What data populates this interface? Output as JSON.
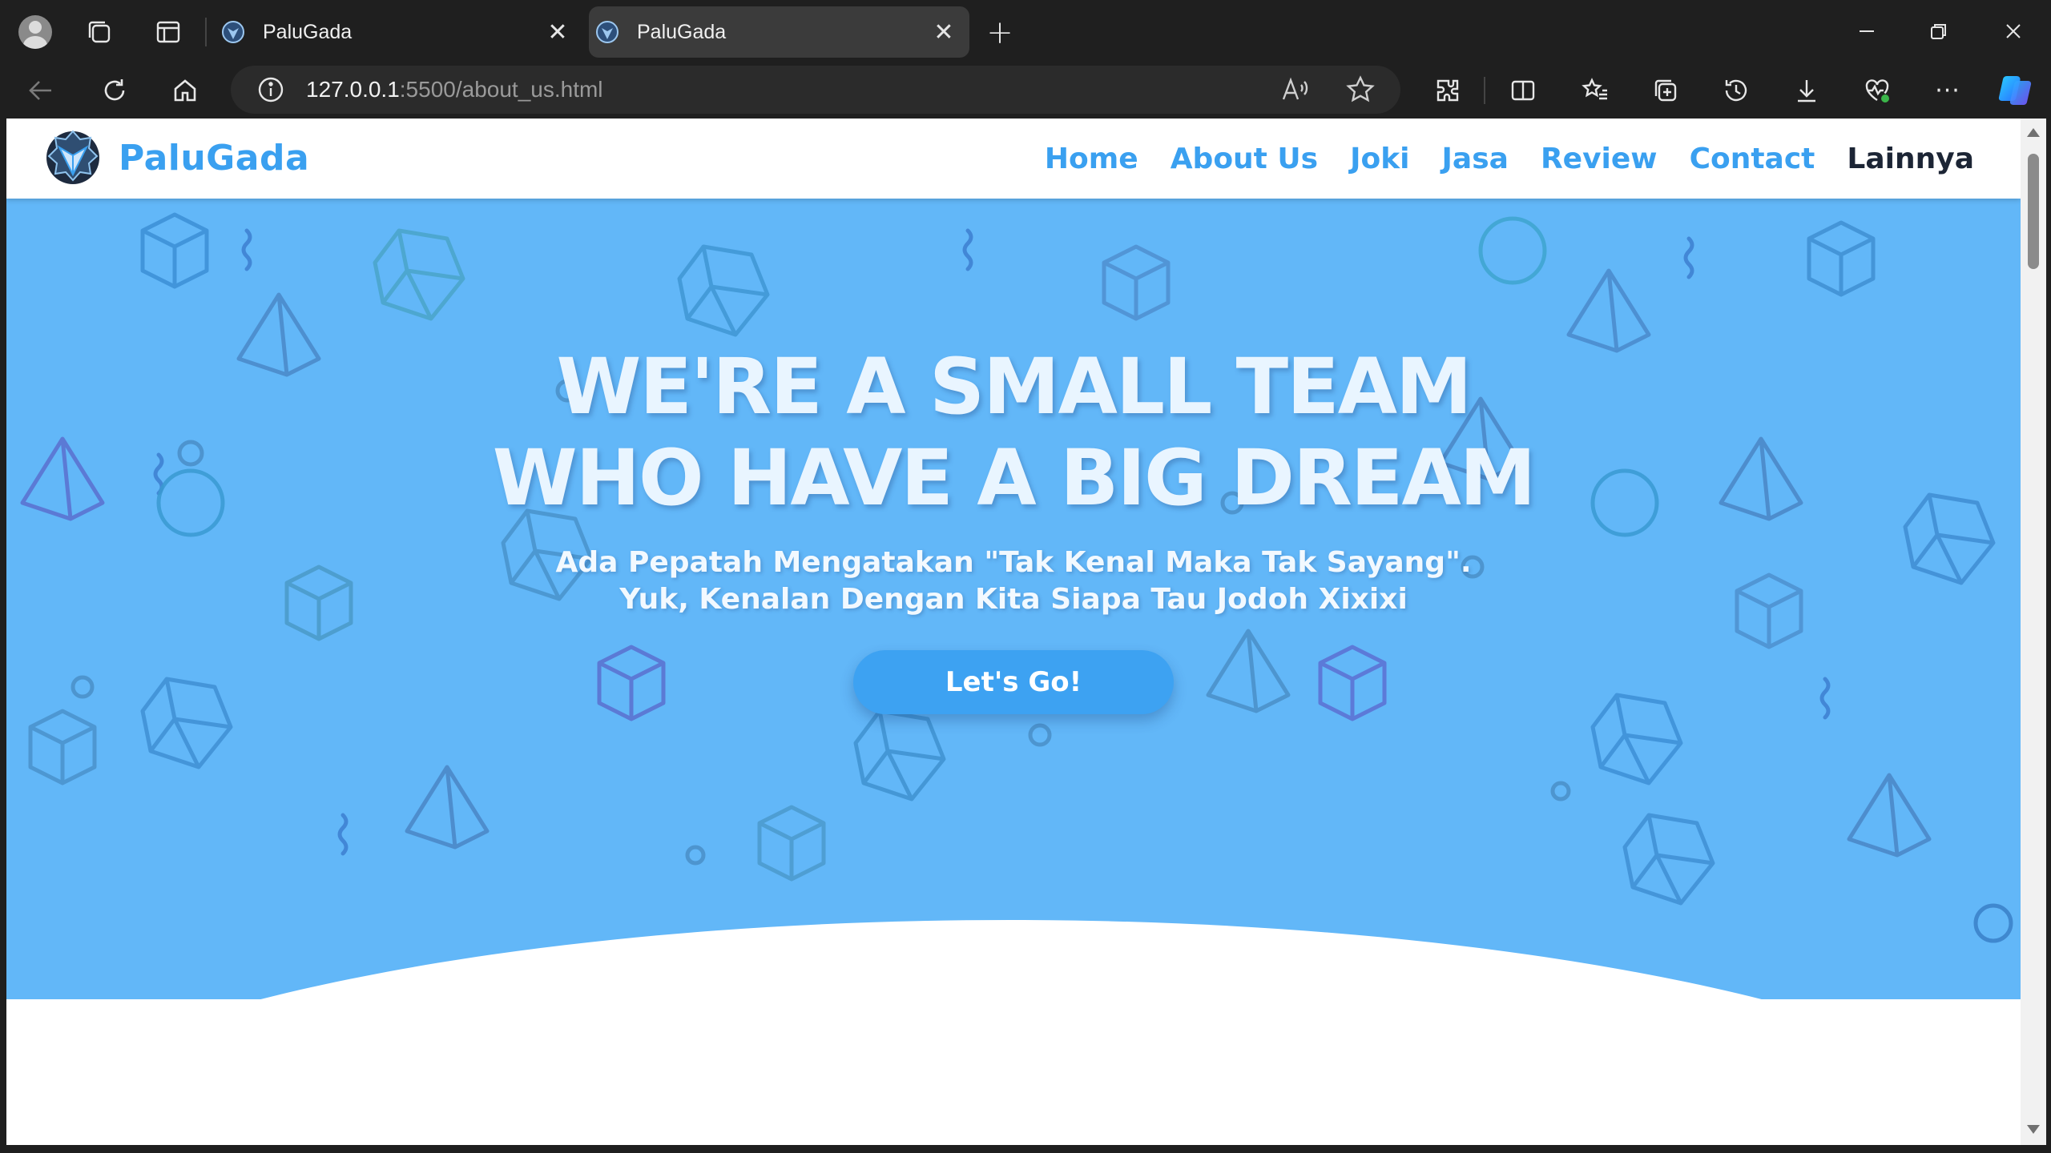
{
  "browser": {
    "tabs": [
      {
        "title": "PaluGada",
        "active": false
      },
      {
        "title": "PaluGada",
        "active": true
      }
    ],
    "url_host": "127.0.0.1",
    "url_rest": ":5500/about_us.html"
  },
  "site": {
    "brand": "PaluGada",
    "nav": [
      "Home",
      "About Us",
      "Joki",
      "Jasa",
      "Review",
      "Contact",
      "Lainnya"
    ]
  },
  "hero": {
    "title_line1": "WE'RE A SMALL TEAM",
    "title_line2": "WHO HAVE A BIG DREAM",
    "subtitle_line1": "Ada Pepatah Mengatakan \"Tak Kenal Maka Tak Sayang\".",
    "subtitle_line2": "Yuk, Kenalan Dengan Kita Siapa Tau Jodoh Xixixi",
    "cta": "Let's Go!"
  },
  "colors": {
    "hero_bg": "#62b7f8",
    "brand_blue": "#3aa0f0",
    "nav_dark": "#1c2535",
    "button": "#3da2f2"
  }
}
